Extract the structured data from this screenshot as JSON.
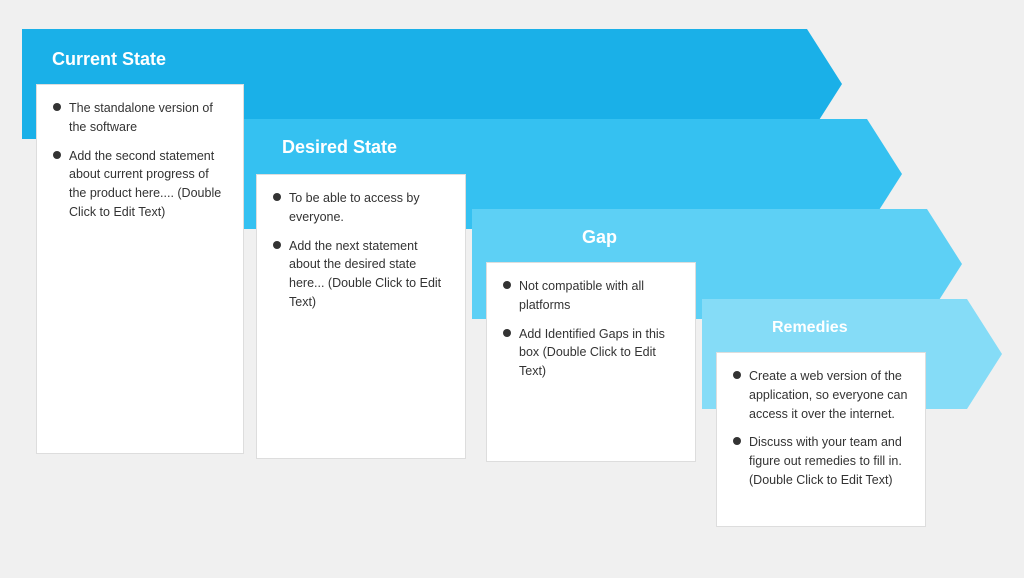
{
  "arrows": [
    {
      "id": "arrow1",
      "label": "Current State",
      "color": "#1ab0e8"
    },
    {
      "id": "arrow2",
      "label": "Desired State",
      "color": "#35c1f1"
    },
    {
      "id": "arrow3",
      "label": "Gap",
      "color": "#5dd0f5"
    },
    {
      "id": "arrow4",
      "label": "Remedies",
      "color": "#85dcf7"
    }
  ],
  "boxes": [
    {
      "id": "box1",
      "items": [
        "The standalone version of the software",
        "Add the second statement about current progress of the product here.... (Double Click to Edit Text)"
      ]
    },
    {
      "id": "box2",
      "items": [
        "To be able to access by everyone.",
        "Add the next statement about the desired state here...    (Double Click to Edit Text)"
      ]
    },
    {
      "id": "box3",
      "items": [
        "Not compatible with all platforms",
        "Add Identified Gaps in this box (Double Click to Edit Text)"
      ]
    },
    {
      "id": "box4",
      "items": [
        "Create a web version of the application, so everyone  can access it over the internet.",
        "Discuss with your team and figure out  remedies to fill in. (Double Click to Edit Text)"
      ]
    }
  ]
}
